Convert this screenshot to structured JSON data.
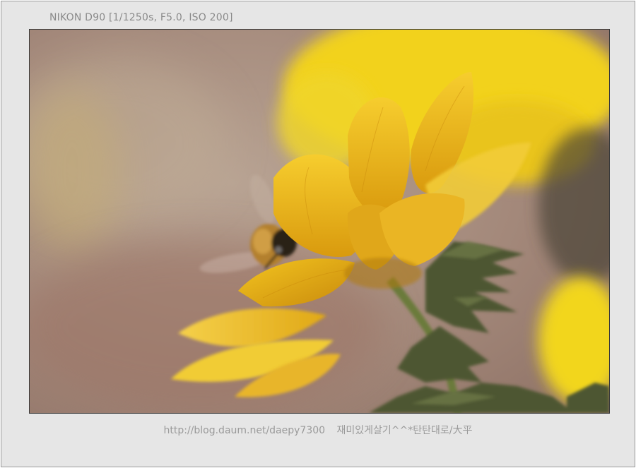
{
  "exif": {
    "text": "NIKON D90 [1/1250s, F5.0, ISO 200]"
  },
  "caption": {
    "url": "http://blog.daum.net/daepy7300",
    "blog_name": "재미있게살기^^*탄탄대로/大平"
  },
  "photo": {
    "subject": "bee on yellow flower",
    "colors": {
      "petal": "#f3c21a",
      "petal_shadow": "#d49a10",
      "background_warm": "#a8897a",
      "leaf": "#4a5230"
    }
  }
}
